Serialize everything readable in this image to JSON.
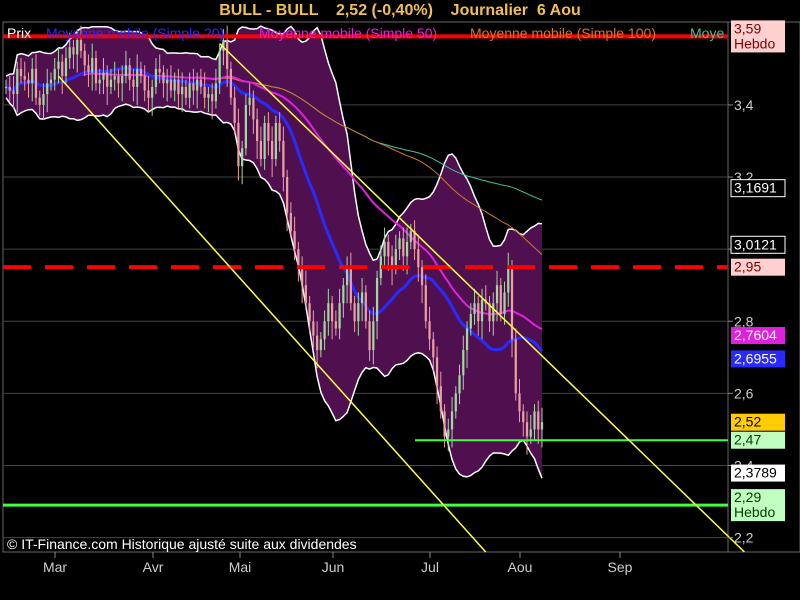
{
  "header": {
    "title": "BULL - BULL    2,52 (-0,40%)    Journalier  6 Aou"
  },
  "legend": {
    "prix": "Prix",
    "items": [
      {
        "label": "Moyenne mobile (Simple 20)",
        "color": "#2a2aff"
      },
      {
        "label": "Moyenne mobile (Simple 50)",
        "color": "#e020e0"
      },
      {
        "label": "Moyenne mobile (Simple 100)",
        "color": "#d07828"
      },
      {
        "label": "Moye",
        "color": "#40c0a0"
      }
    ]
  },
  "copyright": "© IT-Finance.com Historique ajusté suite aux dividendes",
  "colors": {
    "background": "#000000",
    "bollinger_fill": "#501050",
    "bollinger_edge": "#ffffff",
    "candle_up": "#a0d8a0",
    "candle_down": "#e8a0a0",
    "grid": "#444444",
    "resistance": "#ff0000",
    "support": "#40ff40",
    "channel": "#ffff40",
    "price_tag": "#ffcc00"
  },
  "chart_data": {
    "type": "candlestick",
    "title": "BULL - BULL",
    "ylim": [
      2.16,
      3.63
    ],
    "yticks": [
      "2,2",
      "2,4",
      "2,6",
      "2,8",
      "3",
      "3,2",
      "3,4"
    ],
    "months": [
      "Mar",
      "Avr",
      "Mai",
      "Jun",
      "Jul",
      "Aou",
      "Sep"
    ],
    "close": [
      3.45,
      3.44,
      3.43,
      3.5,
      3.48,
      3.47,
      3.46,
      3.5,
      3.42,
      3.4,
      3.43,
      3.46,
      3.47,
      3.5,
      3.52,
      3.48,
      3.53,
      3.56,
      3.54,
      3.58,
      3.55,
      3.51,
      3.49,
      3.53,
      3.46,
      3.47,
      3.49,
      3.45,
      3.47,
      3.48,
      3.46,
      3.48,
      3.51,
      3.47,
      3.45,
      3.5,
      3.48,
      3.44,
      3.42,
      3.45,
      3.5,
      3.49,
      3.46,
      3.47,
      3.44,
      3.47,
      3.43,
      3.45,
      3.42,
      3.46,
      3.44,
      3.47,
      3.45,
      3.42,
      3.43,
      3.41,
      3.46,
      3.55,
      3.58,
      3.5,
      3.42,
      3.35,
      3.23,
      3.28,
      3.4,
      3.42,
      3.36,
      3.3,
      3.25,
      3.35,
      3.3,
      3.25,
      3.35,
      3.3,
      3.2,
      3.1,
      3.05,
      3,
      2.95,
      2.9,
      2.85,
      2.8,
      2.76,
      2.72,
      2.75,
      2.8,
      2.85,
      2.8,
      2.78,
      2.85,
      2.9,
      2.95,
      2.85,
      2.8,
      2.85,
      2.88,
      2.8,
      2.72,
      2.8,
      2.92,
      2.98,
      3.02,
      2.98,
      2.95,
      3,
      3.03,
      2.98,
      3.02,
      3.05,
      3,
      2.95,
      2.9,
      2.8,
      2.75,
      2.7,
      2.62,
      2.55,
      2.48,
      2.5,
      2.55,
      2.6,
      2.65,
      2.72,
      2.78,
      2.82,
      2.85,
      2.8,
      2.86,
      2.85,
      2.8,
      2.85,
      2.9,
      2.82,
      2.88,
      2.95,
      2.75,
      2.6,
      2.55,
      2.52,
      2.48,
      2.5,
      2.55,
      2.5,
      2.52
    ],
    "last_close": 2.52,
    "change_pct": -0.4,
    "sma20_last": 2.6955,
    "sma50_last": 2.7604,
    "sma100_last": 3.0121,
    "sma200_last": 3.1691,
    "bollinger_lower_last": 2.3789,
    "resistance_weekly": 3.59,
    "resistance_dashed": 2.95,
    "support_weekly": 2.29,
    "support_level": 2.47
  },
  "right_axis_tags": [
    {
      "label": "3,59",
      "sub": "Hebdo",
      "price": 3.59,
      "bg": "#ffd0d0",
      "fg": "#800000",
      "kind": "hebdo"
    },
    {
      "label": "3,1691",
      "price": 3.1691,
      "bg": "#000000",
      "fg": "#ffffff",
      "border": "#ffffff"
    },
    {
      "label": "3,0121",
      "price": 3.0121,
      "bg": "#000000",
      "fg": "#ffffff",
      "border": "#ffffff"
    },
    {
      "label": "2,95",
      "price": 2.95,
      "bg": "#ffd0d0",
      "fg": "#800000"
    },
    {
      "label": "2,7604",
      "price": 2.7604,
      "bg": "#e020e0",
      "fg": "#ffffff"
    },
    {
      "label": "2,6955",
      "price": 2.6955,
      "bg": "#2a2aff",
      "fg": "#ffffff"
    },
    {
      "label": "2,52",
      "price": 2.52,
      "bg": "#ffcc00",
      "fg": "#000000"
    },
    {
      "label": "2,47",
      "price": 2.47,
      "bg": "#c0ffc0",
      "fg": "#004000"
    },
    {
      "label": "2,3789",
      "price": 2.3789,
      "bg": "#ffffff",
      "fg": "#000000"
    },
    {
      "label": "2,29",
      "sub": "Hebdo",
      "price": 2.29,
      "bg": "#c0ffc0",
      "fg": "#004000",
      "kind": "hebdo"
    }
  ]
}
